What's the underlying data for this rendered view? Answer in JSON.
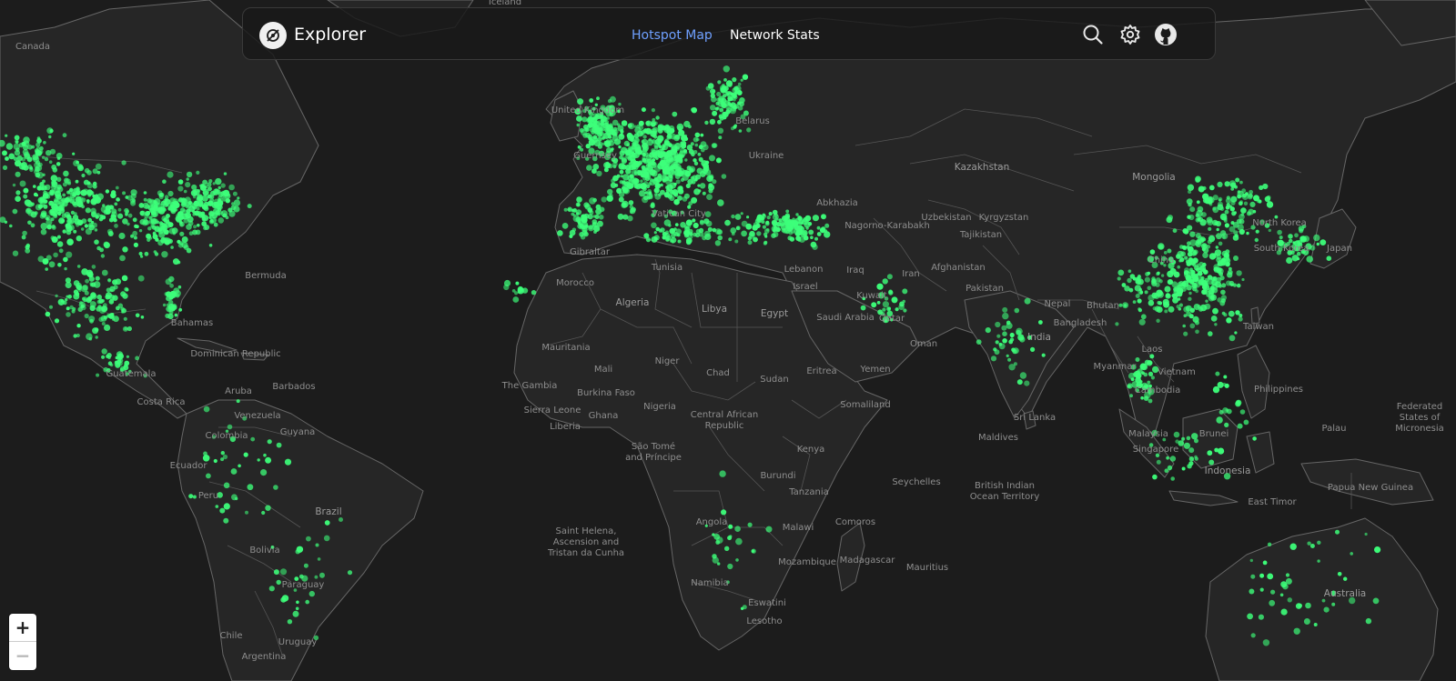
{
  "app": {
    "title": "Explorer"
  },
  "nav": {
    "tabs": [
      {
        "label": "Hotspot Map",
        "active": true
      },
      {
        "label": "Network Stats",
        "active": false
      }
    ],
    "icons": [
      "search-icon",
      "settings-gear-icon",
      "github-icon"
    ]
  },
  "zoom": {
    "in_label": "+",
    "out_label": "−"
  },
  "colors": {
    "hotspot": "#3dff7a",
    "accent": "#6fa0ff",
    "background": "#1c1c1c",
    "land": "#262626",
    "border": "#6a6a6a"
  },
  "map": {
    "places": [
      "Canada",
      "Iceland",
      "Belarus",
      "Ukraine",
      "Kazakhstan",
      "Mongolia",
      "Uzbekistan",
      "Kyrgyzstan",
      "Tajikistan",
      "Afghanistan",
      "Pakistan",
      "North Korea",
      "South Korea",
      "Japan",
      "China",
      "Nepal",
      "Bhutan",
      "Bangladesh",
      "India",
      "Myanmar",
      "Laos",
      "Vietnam",
      "Cambodia",
      "Philippines",
      "Taiwan",
      "Sri Lanka",
      "Maldives",
      "Malaysia",
      "Singapore",
      "Brunei",
      "Indonesia",
      "East Timor",
      "Papua New Guinea",
      "Palau",
      "Federated States of Micronesia",
      "Australia",
      "Iran",
      "Iraq",
      "Kuwait",
      "Qatar",
      "Oman",
      "Yemen",
      "Saudi Arabia",
      "Lebanon",
      "Israel",
      "Abkhazia",
      "Nagorno-Karabakh",
      "Egypt",
      "Libya",
      "Algeria",
      "Morocco",
      "Tunisia",
      "Mauritania",
      "Mali",
      "Niger",
      "Chad",
      "Sudan",
      "Eritrea",
      "Somaliland",
      "The Gambia",
      "Burkina Faso",
      "Sierra Leone",
      "Liberia",
      "Ghana",
      "Nigeria",
      "Central African Republic",
      "Kenya",
      "Burundi",
      "Tanzania",
      "Angola",
      "Malawi",
      "Comoros",
      "Mozambique",
      "Madagascar",
      "Mauritius",
      "Namibia",
      "Eswatini",
      "Lesotho",
      "Seychelles",
      "British Indian Ocean Territory",
      "São Tomé and Príncipe",
      "Saint Helena, Ascension and Tristan da Cunha",
      "Bermuda",
      "Bahamas",
      "Dominican Republic",
      "Guatemala",
      "Costa Rica",
      "Aruba",
      "Barbados",
      "Venezuela",
      "Colombia",
      "Guyana",
      "Ecuador",
      "Peru",
      "Brazil",
      "Bolivia",
      "Paraguay",
      "Chile",
      "Uruguay",
      "Argentina",
      "Gibraltar",
      "United Kingdom",
      "Guernsey",
      "Vatican City"
    ]
  }
}
